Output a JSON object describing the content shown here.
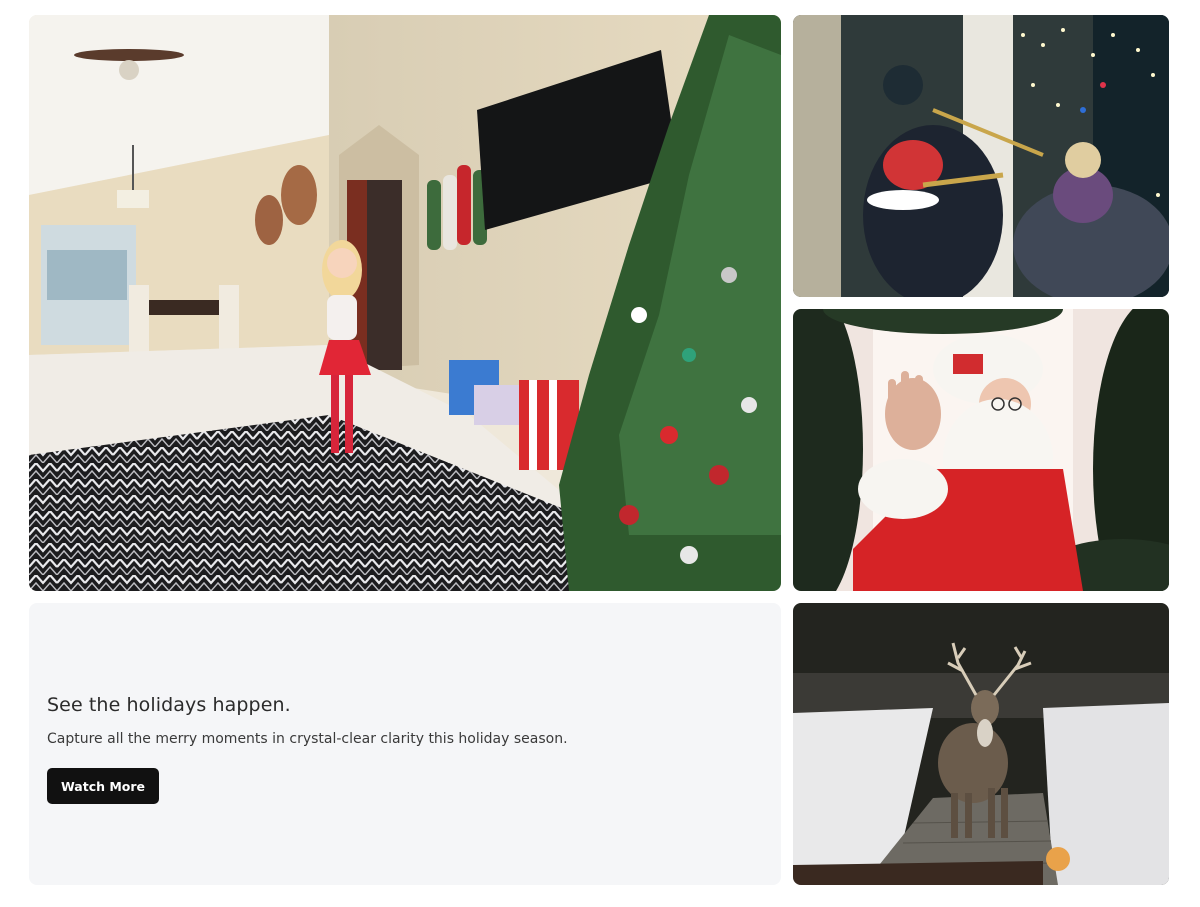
{
  "promo": {
    "heading": "See the holidays happen.",
    "subheading": "Capture all the merry moments in crystal-clear clarity this holiday season.",
    "button_label": "Watch More"
  },
  "tiles": [
    {
      "name": "living-room-christmas-tree-camera-image"
    },
    {
      "name": "brass-band-porch-camera-image"
    },
    {
      "name": "santa-waving-doorbell-camera-image"
    },
    {
      "name": "deer-snowy-yard-camera-image"
    }
  ],
  "colors": {
    "card_background": "#f5f6f8",
    "button_background": "#111111",
    "button_text": "#ffffff",
    "heading_text": "#2b2b2b"
  }
}
